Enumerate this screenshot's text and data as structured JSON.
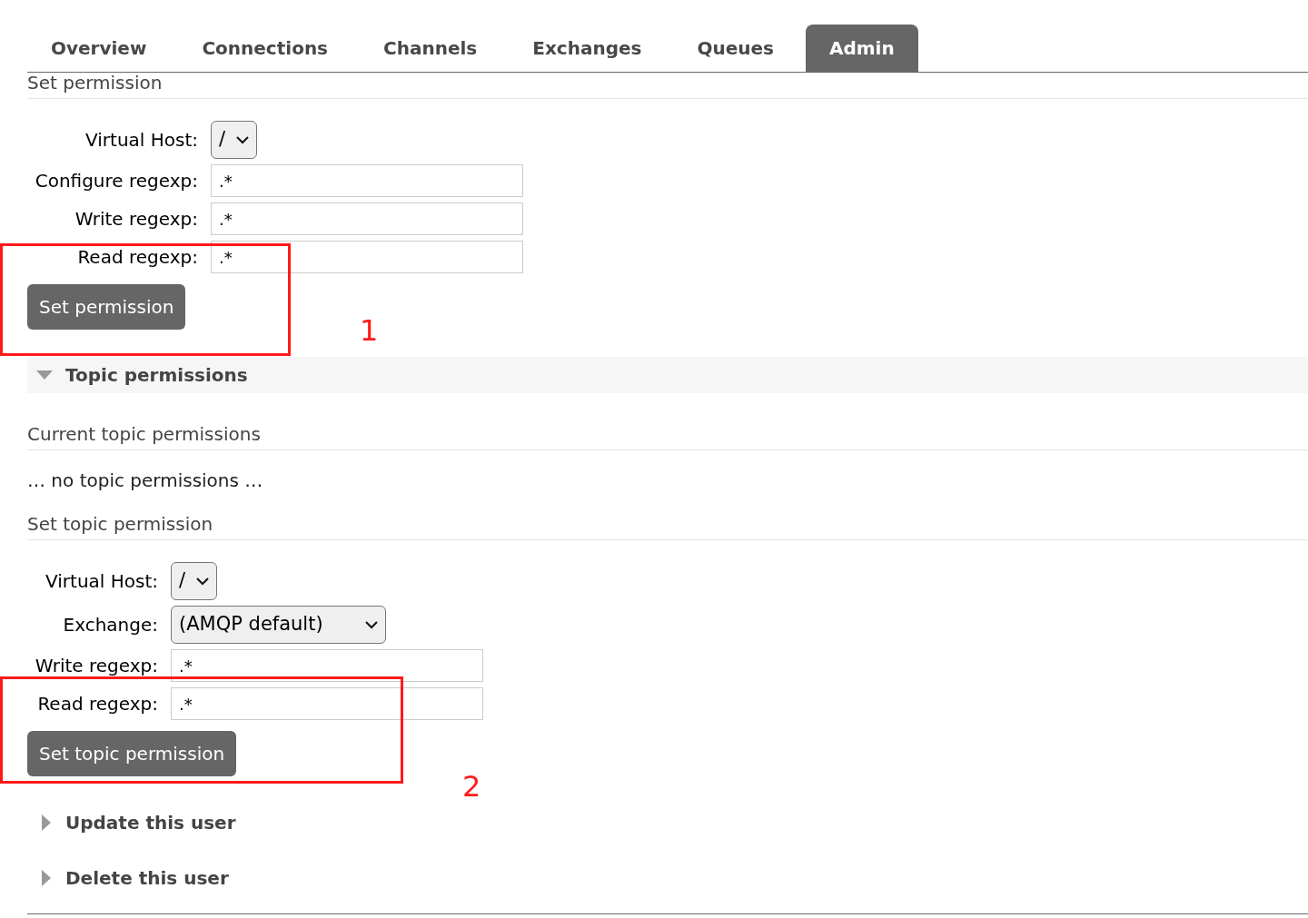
{
  "tabs": [
    {
      "label": "Overview",
      "selected": false
    },
    {
      "label": "Connections",
      "selected": false
    },
    {
      "label": "Channels",
      "selected": false
    },
    {
      "label": "Exchanges",
      "selected": false
    },
    {
      "label": "Queues",
      "selected": false
    },
    {
      "label": "Admin",
      "selected": true
    }
  ],
  "set_permission": {
    "heading": "Set permission",
    "fields": [
      {
        "kind": "select",
        "label": "Virtual Host:",
        "value": "/"
      },
      {
        "kind": "input",
        "label": "Configure regexp:",
        "value": ".*"
      },
      {
        "kind": "input",
        "label": "Write regexp:",
        "value": ".*"
      },
      {
        "kind": "input",
        "label": "Read regexp:",
        "value": ".*"
      }
    ],
    "button": "Set permission"
  },
  "topic_permissions": {
    "title": "Topic permissions",
    "expanded": true,
    "current_heading": "Current topic permissions",
    "empty_text": "… no topic permissions …",
    "set_heading": "Set topic permission",
    "fields": [
      {
        "kind": "select",
        "label": "Virtual Host:",
        "value": "/"
      },
      {
        "kind": "select",
        "label": "Exchange:",
        "value": "(AMQP default)"
      },
      {
        "kind": "input",
        "label": "Write regexp:",
        "value": ".*"
      },
      {
        "kind": "input",
        "label": "Read regexp:",
        "value": ".*"
      }
    ],
    "button": "Set topic permission"
  },
  "sections": [
    {
      "title": "Update this user",
      "expanded": false
    },
    {
      "title": "Delete this user",
      "expanded": false
    }
  ],
  "annotations": [
    {
      "label": "1"
    },
    {
      "label": "2"
    }
  ]
}
